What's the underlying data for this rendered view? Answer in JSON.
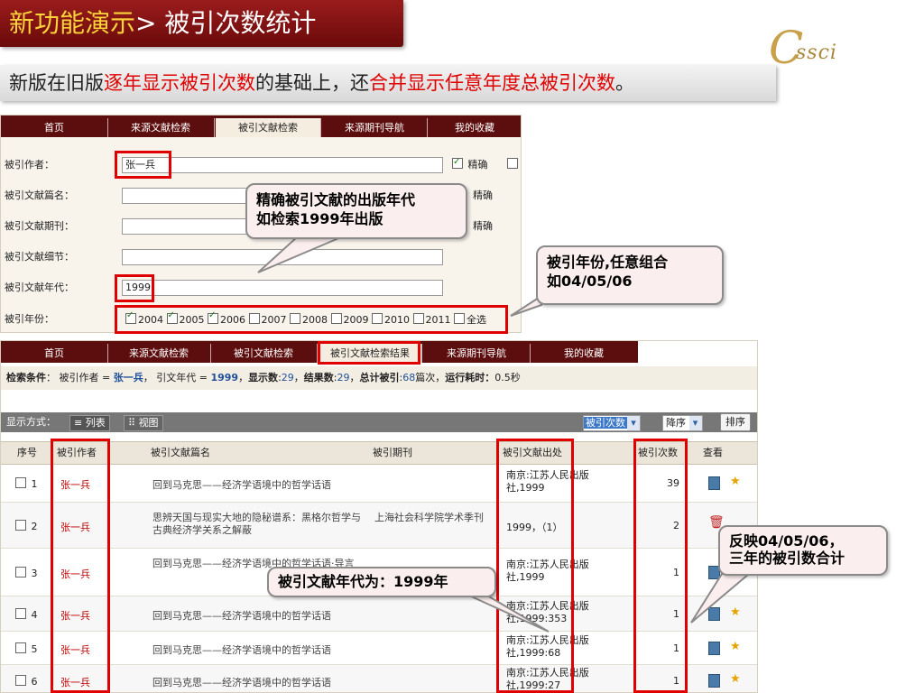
{
  "header": {
    "title_main": "新功能演示",
    "title_rest": "> 被引次数统计",
    "logo_c": "C",
    "logo_text": "ssci"
  },
  "subtitle": {
    "p1": "新版在旧版",
    "p2": "逐年显示被引次数",
    "p3": "的基础上，还",
    "p4": "合并显示任意年度总被引次数",
    "p5": "。"
  },
  "form": {
    "tabs": [
      "首页",
      "来源文献检索",
      "被引文献检索",
      "来源期刊导航",
      "我的收藏"
    ],
    "active_tab": 2,
    "fields": [
      {
        "label": "被引作者：",
        "value": ""
      },
      {
        "label": "被引文献篇名：",
        "value": ""
      },
      {
        "label": "被引文献期刊：",
        "value": ""
      },
      {
        "label": "被引文献细节：",
        "value": ""
      },
      {
        "label": "被引文献年代：",
        "value": ""
      },
      {
        "label": "被引年份：",
        "value": ""
      }
    ],
    "author_value": "张一兵",
    "year_value": "1999",
    "precise_label": "精确",
    "years": [
      {
        "label": "2004",
        "checked": true
      },
      {
        "label": "2005",
        "checked": true
      },
      {
        "label": "2006",
        "checked": true
      },
      {
        "label": "2007",
        "checked": false
      },
      {
        "label": "2008",
        "checked": false
      },
      {
        "label": "2009",
        "checked": false
      },
      {
        "label": "2010",
        "checked": false
      },
      {
        "label": "2011",
        "checked": false
      }
    ],
    "select_all": "全选"
  },
  "results": {
    "tabs": [
      "首页",
      "来源文献检索",
      "被引文献检索",
      "被引文献检索结果",
      "来源期刊导航",
      "我的收藏"
    ],
    "active_tab": 3,
    "conditions": {
      "label": "检索条件",
      "sep": "：",
      "t1": "被引作者 = ",
      "author": "张一兵",
      "t2": "，  引文年代 = ",
      "year": "1999",
      "t3": "，",
      "shown_label": "显示数",
      "shown": "29",
      "result_label": "结果数",
      "result": "29",
      "total_label": "总计被引",
      "total": "68",
      "t4": "篇次，",
      "time_label": "运行耗时：",
      "time": "0.5秒"
    },
    "display_label": "显示方式：",
    "view_list": "列表",
    "view_grid": "视图",
    "sort_field": "被引次数",
    "sort_order": "降序",
    "sort_button": "排序",
    "columns": [
      "序号",
      "被引作者",
      "被引文献篇名",
      "被引期刊",
      "被引文献出处",
      "被引次数",
      "查看"
    ],
    "rows": [
      {
        "no": "1",
        "author": "张一兵",
        "title": "回到马克思——经济学语境中的哲学话语",
        "journal": "",
        "source": "南京:江苏人民出版社,1999",
        "count": "39"
      },
      {
        "no": "2",
        "author": "张一兵",
        "title": "思辨天国与现实大地的隐秘谱系：黑格尔哲学与古典经济学关系之解蔽",
        "journal": "上海社会科学院学术季刊",
        "source": "1999，（1）",
        "count": "2"
      },
      {
        "no": "3",
        "author": "张一兵",
        "title": "回到马克思——经济学语境中的哲学话语·导言",
        "journal": "",
        "source": "南京:江苏人民出版社,1999",
        "count": "1"
      },
      {
        "no": "4",
        "author": "张一兵",
        "title": "回到马克思——经济学语境中的哲学话语",
        "journal": "",
        "source": "南京:江苏人民出版社,1999:353",
        "count": "1"
      },
      {
        "no": "5",
        "author": "张一兵",
        "title": "回到马克思——经济学语境中的哲学话语",
        "journal": "",
        "source": "南京:江苏人民出版社,1999:68",
        "count": "1"
      },
      {
        "no": "6",
        "author": "张一兵",
        "title": "回到马克思——经济学语境中的哲学话语",
        "journal": "",
        "source": "南京:江苏人民出版社,1999:27",
        "count": "1"
      }
    ]
  },
  "callouts": {
    "precise_year": "精确被引文献的出版年代\n如检索1999年出版",
    "cited_year": "被引年份,任意组合\n如04/05/06",
    "year_1999": "被引文献年代为：1999年",
    "reflect": "反映04/05/06，\n三年的被引数合计"
  },
  "colors": {
    "banner": "#8b1515",
    "accent_red": "#e00000",
    "tab_bar": "#5c0d0d"
  }
}
